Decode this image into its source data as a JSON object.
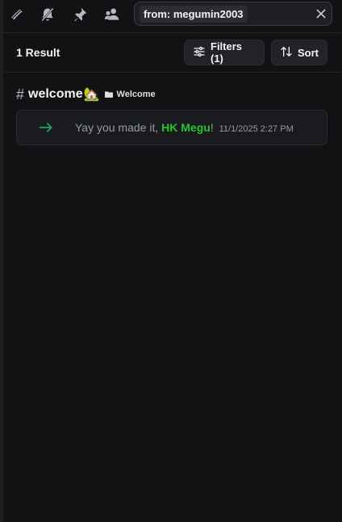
{
  "toolbar": {
    "icons": [
      "threads-icon",
      "notifications-muted-icon",
      "pinned-messages-icon",
      "member-list-icon"
    ]
  },
  "search": {
    "filter_chip": "from: megumin2003"
  },
  "results": {
    "count_label": "1 Result",
    "filters_label": "Filters (1)",
    "sort_label": "Sort"
  },
  "channel": {
    "hash": "#",
    "name": "welcome",
    "emoji": "🏡",
    "category": "Welcome"
  },
  "message": {
    "text_before": "Yay you made it, ",
    "username": "HK Megu",
    "text_after": "!",
    "timestamp": "11/1/2025 2:27 PM",
    "join_color": "#23a559"
  },
  "colors": {
    "background": "#121214",
    "accent_green": "#23c52f"
  }
}
